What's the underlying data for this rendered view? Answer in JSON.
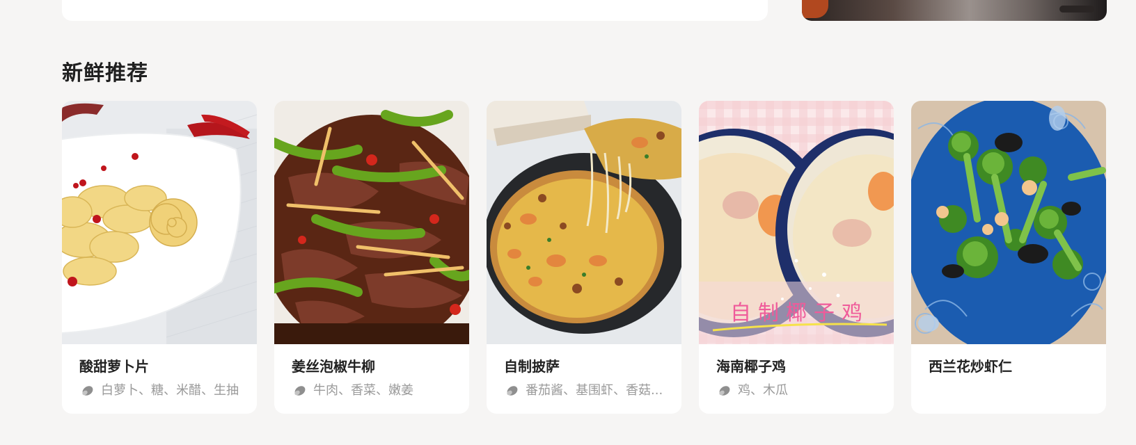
{
  "section": {
    "title": "新鲜推荐"
  },
  "cards": [
    {
      "name": "酸甜萝卜片",
      "ingredients": "白萝卜、糖、米醋、生抽"
    },
    {
      "name": "姜丝泡椒牛柳",
      "ingredients": "牛肉、香菜、嫩姜"
    },
    {
      "name": "自制披萨",
      "ingredients": "番茄酱、基围虾、香菇..."
    },
    {
      "name": "海南椰子鸡",
      "ingredients": "鸡、木瓜",
      "image_caption": "自制椰子鸡"
    },
    {
      "name": "西兰花炒虾仁",
      "ingredients": ""
    }
  ],
  "icons": {
    "ingredient": "ingredient-leaf-icon"
  },
  "colors": {
    "background": "#f6f5f4",
    "card": "#ffffff",
    "title": "#1f1f1f",
    "muted": "#9a9a9a"
  }
}
